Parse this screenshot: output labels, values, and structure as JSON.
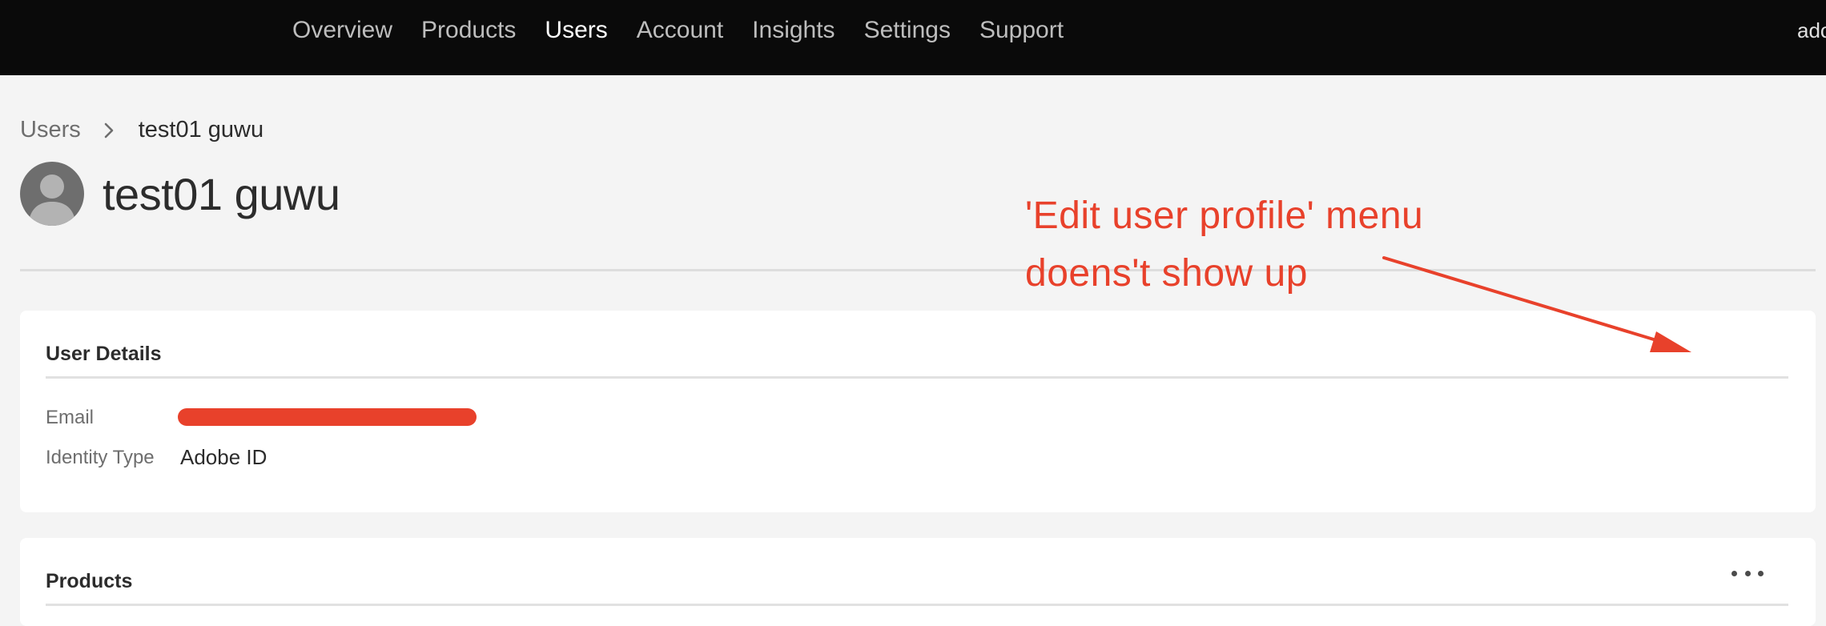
{
  "nav": {
    "items": [
      {
        "label": "Overview",
        "active": false
      },
      {
        "label": "Products",
        "active": false
      },
      {
        "label": "Users",
        "active": true
      },
      {
        "label": "Account",
        "active": false
      },
      {
        "label": "Insights",
        "active": false
      },
      {
        "label": "Settings",
        "active": false
      },
      {
        "label": "Support",
        "active": false
      }
    ],
    "right_text": "adc"
  },
  "breadcrumb": {
    "parent": "Users",
    "separator_icon": "chevron-right-icon",
    "current": "test01 guwu"
  },
  "user": {
    "avatar_icon": "user-avatar-icon",
    "name": "test01 guwu"
  },
  "user_details": {
    "heading": "User Details",
    "email_label": "Email",
    "email_value_redacted": true,
    "identity_type_label": "Identity Type",
    "identity_type_value": "Adobe ID"
  },
  "products": {
    "heading": "Products",
    "more_icon": "more-options-icon"
  },
  "annotation": {
    "line1": "'Edit user profile' menu",
    "line2": "doens't show up",
    "color": "#e8412b"
  }
}
